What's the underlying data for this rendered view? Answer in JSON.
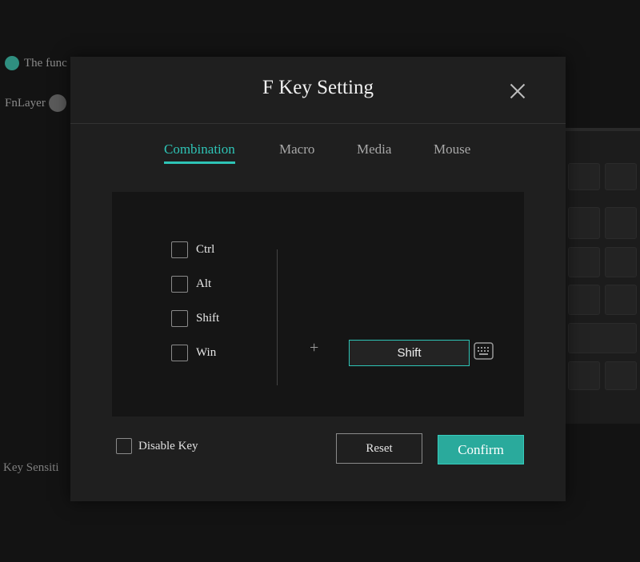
{
  "background": {
    "function_text": "The func",
    "fnlayer_label": "FnLayer",
    "key_sensitivity_label": "Key Sensiti"
  },
  "dialog": {
    "title": "F Key Setting",
    "tabs": [
      {
        "label": "Combination",
        "active": true
      },
      {
        "label": "Macro",
        "active": false
      },
      {
        "label": "Media",
        "active": false
      },
      {
        "label": "Mouse",
        "active": false
      }
    ],
    "modifiers": [
      {
        "label": "Ctrl",
        "checked": false
      },
      {
        "label": "Alt",
        "checked": false
      },
      {
        "label": "Shift",
        "checked": false
      },
      {
        "label": "Win",
        "checked": false
      }
    ],
    "plus_symbol": "+",
    "key_value": "Shift",
    "disable_key": {
      "label": "Disable Key",
      "checked": false
    },
    "reset_label": "Reset",
    "confirm_label": "Confirm"
  },
  "colors": {
    "accent": "#2ec4b6",
    "confirm_bg": "#2aaa9c",
    "dialog_bg": "#1f1f1f",
    "panel_bg": "#151515"
  }
}
